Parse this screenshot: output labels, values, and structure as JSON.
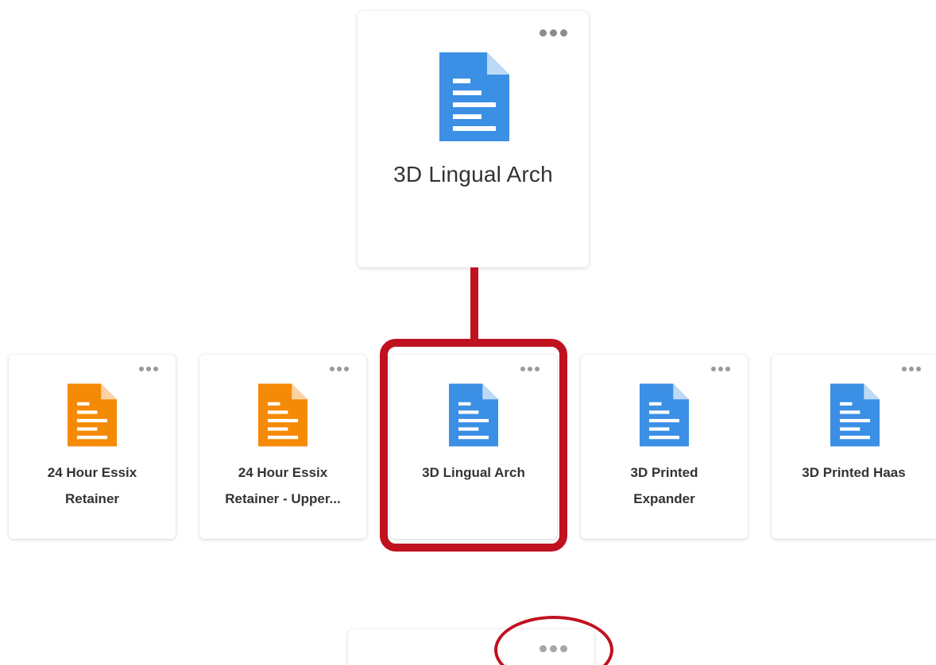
{
  "colors": {
    "blue_doc": "#3b8fe4",
    "orange_doc": "#f58a07",
    "highlight": "#c0111f"
  },
  "parent_card": {
    "title": "3D Lingual Arch",
    "icon": "document-icon",
    "icon_color": "blue",
    "menu_icon": "more-options-icon"
  },
  "child_cards": [
    {
      "title_line1": "24 Hour Essix",
      "title_line2": "Retainer",
      "icon": "document-icon",
      "icon_color": "orange"
    },
    {
      "title_line1": "24 Hour Essix",
      "title_line2": "Retainer - Upper...",
      "icon": "document-icon",
      "icon_color": "orange"
    },
    {
      "title_line1": "3D Lingual Arch",
      "title_line2": "",
      "icon": "document-icon",
      "icon_color": "blue",
      "highlighted": true
    },
    {
      "title_line1": "3D Printed",
      "title_line2": "Expander",
      "icon": "document-icon",
      "icon_color": "blue"
    },
    {
      "title_line1": "3D Printed Haas",
      "title_line2": "",
      "icon": "document-icon",
      "icon_color": "blue"
    }
  ],
  "bottom_card": {
    "menu_icon": "more-options-icon",
    "menu_highlighted": true
  }
}
